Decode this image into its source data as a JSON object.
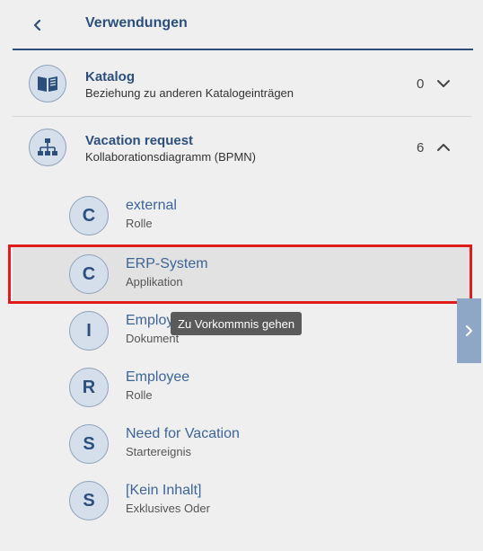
{
  "header": {
    "title": "Verwendungen"
  },
  "groups": [
    {
      "title": "Katalog",
      "subtitle": "Beziehung zu anderen Katalogeinträgen",
      "count": "0",
      "icon": "open-book-icon",
      "expanded": false
    },
    {
      "title": "Vacation request",
      "subtitle": "Kollaborationsdiagramm (BPMN)",
      "count": "6",
      "icon": "org-chart-icon",
      "expanded": true
    }
  ],
  "items": [
    {
      "letter": "C",
      "name": "external",
      "type": "Rolle"
    },
    {
      "letter": "C",
      "name": "ERP-System",
      "type": "Applikation"
    },
    {
      "letter": "I",
      "name": "Employ",
      "type": "Dokument"
    },
    {
      "letter": "R",
      "name": "Employee",
      "type": "Rolle"
    },
    {
      "letter": "S",
      "name": "Need for Vacation",
      "type": "Startereignis"
    },
    {
      "letter": "S",
      "name": "[Kein Inhalt]",
      "type": "Exklusives Oder"
    }
  ],
  "tooltip": {
    "text": "Zu Vorkommnis gehen"
  },
  "colors": {
    "accent": "#2c4f7c",
    "link": "#3d6598",
    "avatar_bg": "#d5dfeb",
    "side_toggle": "#8ea7c6",
    "highlight": "#e01b1b"
  }
}
